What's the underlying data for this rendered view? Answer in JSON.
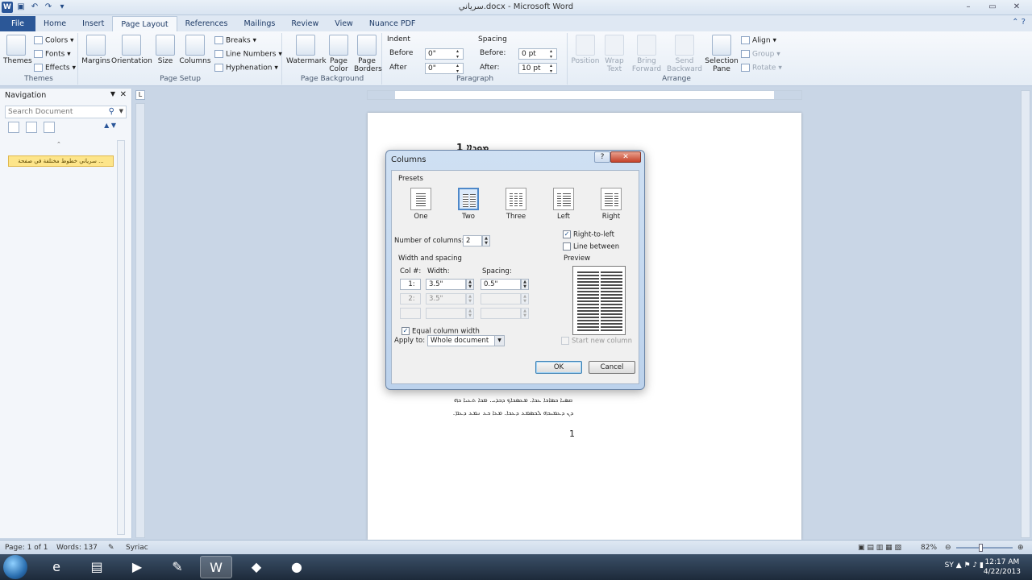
{
  "window": {
    "title": "ﺳﺮﯾﺎﻧﻲ.docx - Microsoft Word"
  },
  "tabs": [
    "File",
    "Home",
    "Insert",
    "Page Layout",
    "References",
    "Mailings",
    "Review",
    "View",
    "Nuance PDF"
  ],
  "ribbon": {
    "themes": {
      "themes_label": "Themes",
      "colors": "Colors",
      "fonts": "Fonts",
      "effects": "Effects",
      "group": "Themes"
    },
    "page_setup": {
      "margins": "Margins",
      "orientation": "Orientation",
      "size": "Size",
      "columns": "Columns",
      "breaks": "Breaks",
      "line_numbers": "Line Numbers",
      "hyphenation": "Hyphenation",
      "group": "Page Setup"
    },
    "page_background": {
      "watermark": "Watermark",
      "page_color": "Page Color",
      "page_borders": "Page Borders",
      "group": "Page Background"
    },
    "paragraph": {
      "indent": "Indent",
      "spacing": "Spacing",
      "left_label": "Before",
      "left_value": "0\"",
      "right_label": "After",
      "right_value": "0\"",
      "before_label": "Before:",
      "before_value": "0 pt",
      "after_label": "After:",
      "after_value": "10 pt",
      "group": "Paragraph"
    },
    "arrange": {
      "position": "Position",
      "wrap_text": "Wrap Text",
      "bring_forward": "Bring Forward",
      "send_backward": "Send Backward",
      "selection_pane": "Selection Pane",
      "align": "Align",
      "group_btn": "Group",
      "rotate": "Rotate",
      "group": "Arrange"
    }
  },
  "navigation": {
    "title": "Navigation",
    "search_placeholder": "Search Document",
    "heading_item": "ﺳﺮﯾﺎﻧﻲ ﺧﻄﻮط ﻣﺨﺘﻠﻔﺔ ﻓﻲ ﺻﻔﺤﺔ ..."
  },
  "document": {
    "heading": "ܡܘܕܐܐ 1",
    "line1": "ܩܣܝܐ ܟܣܐܟܐ ܥܟܐ. ܡܥܣܟܐܟ ܕܟܕܝ. ܡܟܐ ܬܥܝܐ ܟܗ",
    "line2": "ܕܢ ܕܥܡܝܟܗ ܠܟܣܡܥ ܕܥܟܐ. ܡܥܐ ܟܥ ܢܡܥ ܕܥܡ.",
    "page_number": "1"
  },
  "dialog": {
    "title": "Columns",
    "help": "?",
    "close": "✕",
    "presets_label": "Presets",
    "presets": [
      "One",
      "Two",
      "Three",
      "Left",
      "Right"
    ],
    "selected_preset": "Two",
    "num_columns_label": "Number of columns:",
    "num_columns_value": "2",
    "right_to_left_label": "Right-to-left",
    "right_to_left_checked": true,
    "line_between_label": "Line between",
    "line_between_checked": false,
    "width_spacing_label": "Width and spacing",
    "col_header": "Col #:",
    "width_header": "Width:",
    "spacing_header": "Spacing:",
    "rows": [
      {
        "col": "1:",
        "width": "3.5\"",
        "spacing": "0.5\""
      },
      {
        "col": "2:",
        "width": "3.5\"",
        "spacing": ""
      }
    ],
    "equal_width_label": "Equal column width",
    "equal_width_checked": true,
    "preview_label": "Preview",
    "apply_to_label": "Apply to:",
    "apply_to_value": "Whole document",
    "start_new_column_label": "Start new column",
    "ok": "OK",
    "cancel": "Cancel"
  },
  "status": {
    "page": "Page: 1 of 1",
    "words": "Words: 137",
    "language": "Syriac",
    "zoom": "82%"
  },
  "taskbar": {
    "lang": "SY",
    "time": "12:17 AM",
    "date": "4/22/2013"
  },
  "colors": {
    "accent": "#2b5797",
    "dialog_frame": "#bcd2ec",
    "close_red": "#c4422b"
  }
}
